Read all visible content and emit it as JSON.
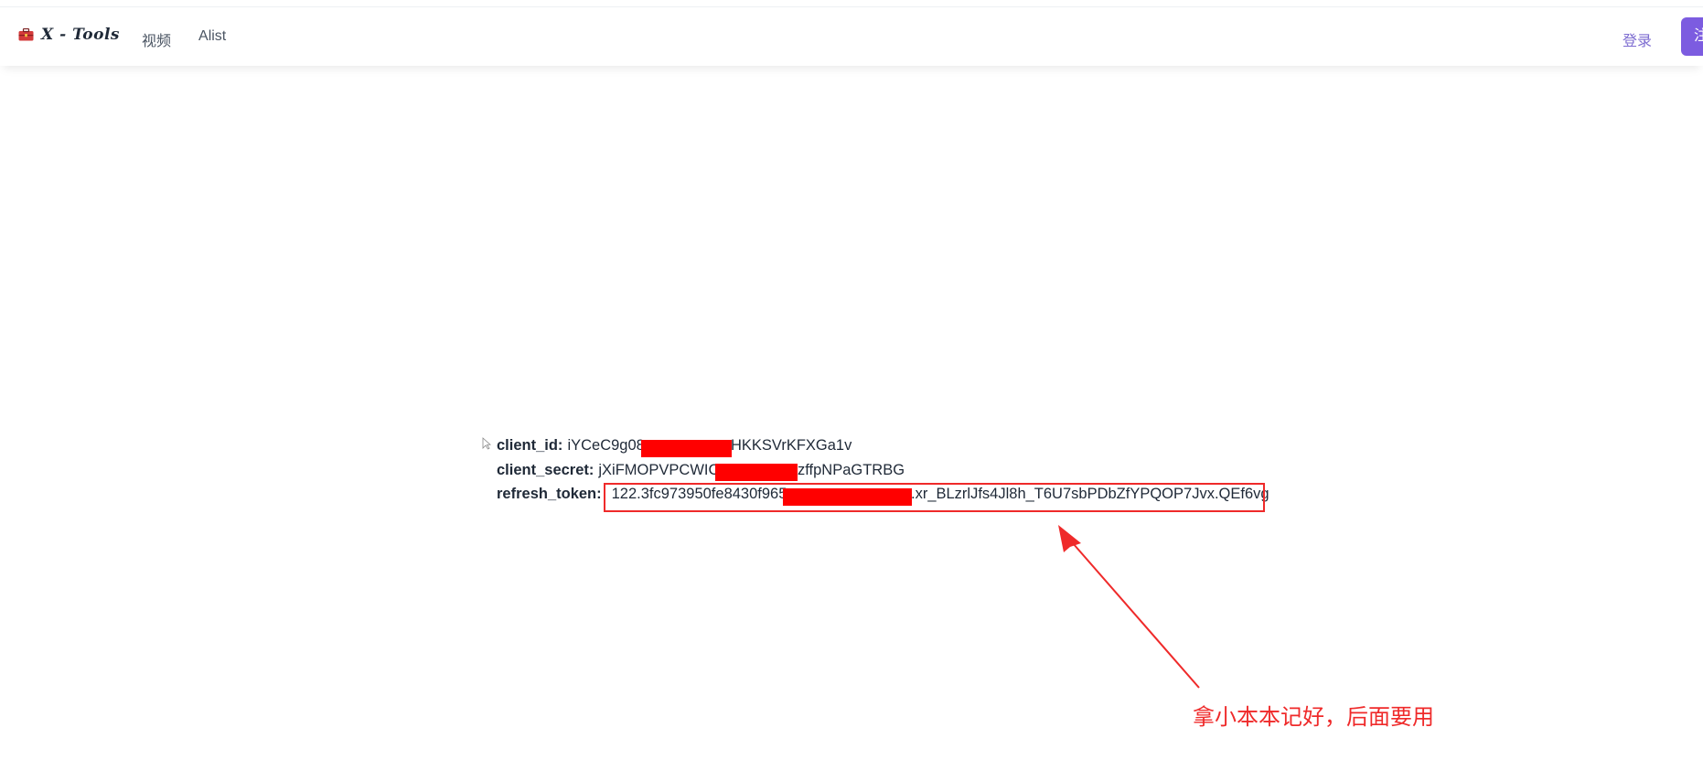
{
  "navbar": {
    "brand": "X - Tools",
    "brand_icon": "toolbox-icon",
    "links": [
      "视频",
      "Alist"
    ],
    "login": "登录",
    "register": "注"
  },
  "credentials": [
    {
      "key": "client_id:",
      "value_pre": "iYCeC9g08",
      "value_post": "HKKSVrKFXGa1v"
    },
    {
      "key": "client_secret:",
      "value_pre": "jXiFMOPVPCWIC",
      "value_post": "zffpNPaGTRBG"
    },
    {
      "key": "refresh_token:",
      "value_pre": "122.3fc973950fe8430f965",
      "value_post": ".xr_BLzrlJfs4Jl8h_T6U7sbPDbZfYPQOP7Jvx.QEf6vg"
    }
  ],
  "annotation": {
    "text": "拿小本本记好，后面要用",
    "color": "#ef2a2a"
  },
  "colors": {
    "accent": "#7c5ce0",
    "redaction": "#ff0000"
  }
}
